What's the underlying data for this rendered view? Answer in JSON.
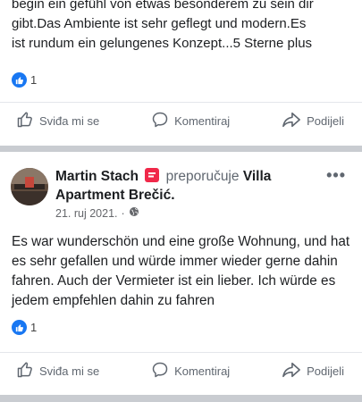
{
  "posts": [
    {
      "text_lines": [
        "begin ein gefühl von etwas besonderem zu sein dir",
        "gibt.Das Ambiente ist sehr geflegt und modern.Es",
        "ist rundum ein gelungenes Konzept...5 Sterne plus"
      ],
      "reaction_count": "1"
    },
    {
      "author": "Martin Stach",
      "verb": "preporučuje",
      "page": "Villa Apartment Brečić",
      "page_suffix": ".",
      "date": "21. ruj 2021.",
      "date_sep": "·",
      "more_label": "•••",
      "text": "Es war wunderschön und eine große Wohnung, und hat es sehr gefallen und würde immer wieder gerne dahin fahren. Auch der Vermieter ist ein lieber. Ich würde es jedem empfehlen dahin zu fahren",
      "reaction_count": "1"
    }
  ],
  "actions": {
    "like": "Sviđa mi se",
    "comment": "Komentiraj",
    "share": "Podijeli"
  },
  "colors": {
    "like_blue": "#1877f2",
    "recommend_red": "#f02849",
    "separator": "#c9ccd1"
  },
  "icons": [
    "thumbs-up-icon",
    "comment-icon",
    "share-icon",
    "globe-icon",
    "recommend-icon",
    "more-icon"
  ]
}
